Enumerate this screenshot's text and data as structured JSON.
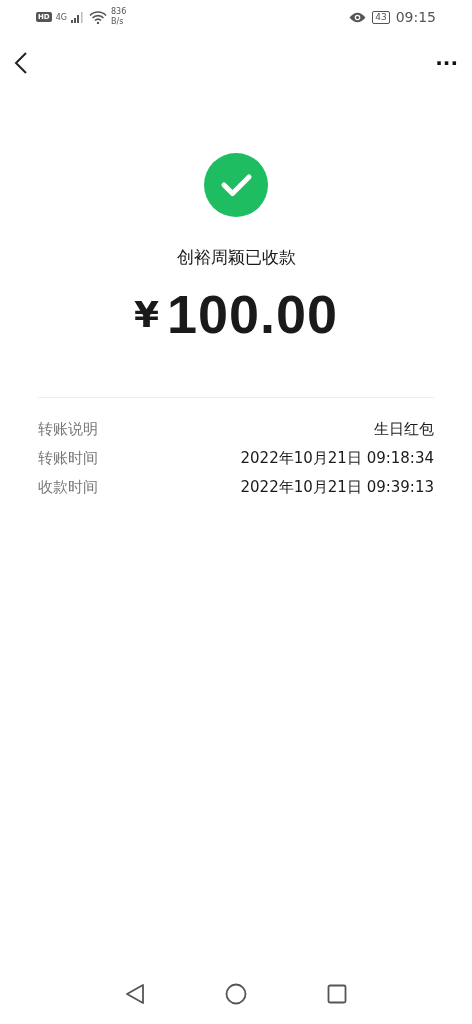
{
  "status_bar": {
    "hd": "HD",
    "network": "4G",
    "speed_value": "836",
    "speed_unit": "B/s",
    "battery": "43",
    "time": "09:15"
  },
  "header": {
    "more": "···"
  },
  "receipt": {
    "title": "创裕周颖已收款",
    "currency": "¥",
    "amount": "100.00"
  },
  "details": [
    {
      "label": "转账说明",
      "value": "生日红包"
    },
    {
      "label": "转账时间",
      "value": "2022年10月21日 09:18:34"
    },
    {
      "label": "收款时间",
      "value": "2022年10月21日 09:39:13"
    }
  ]
}
